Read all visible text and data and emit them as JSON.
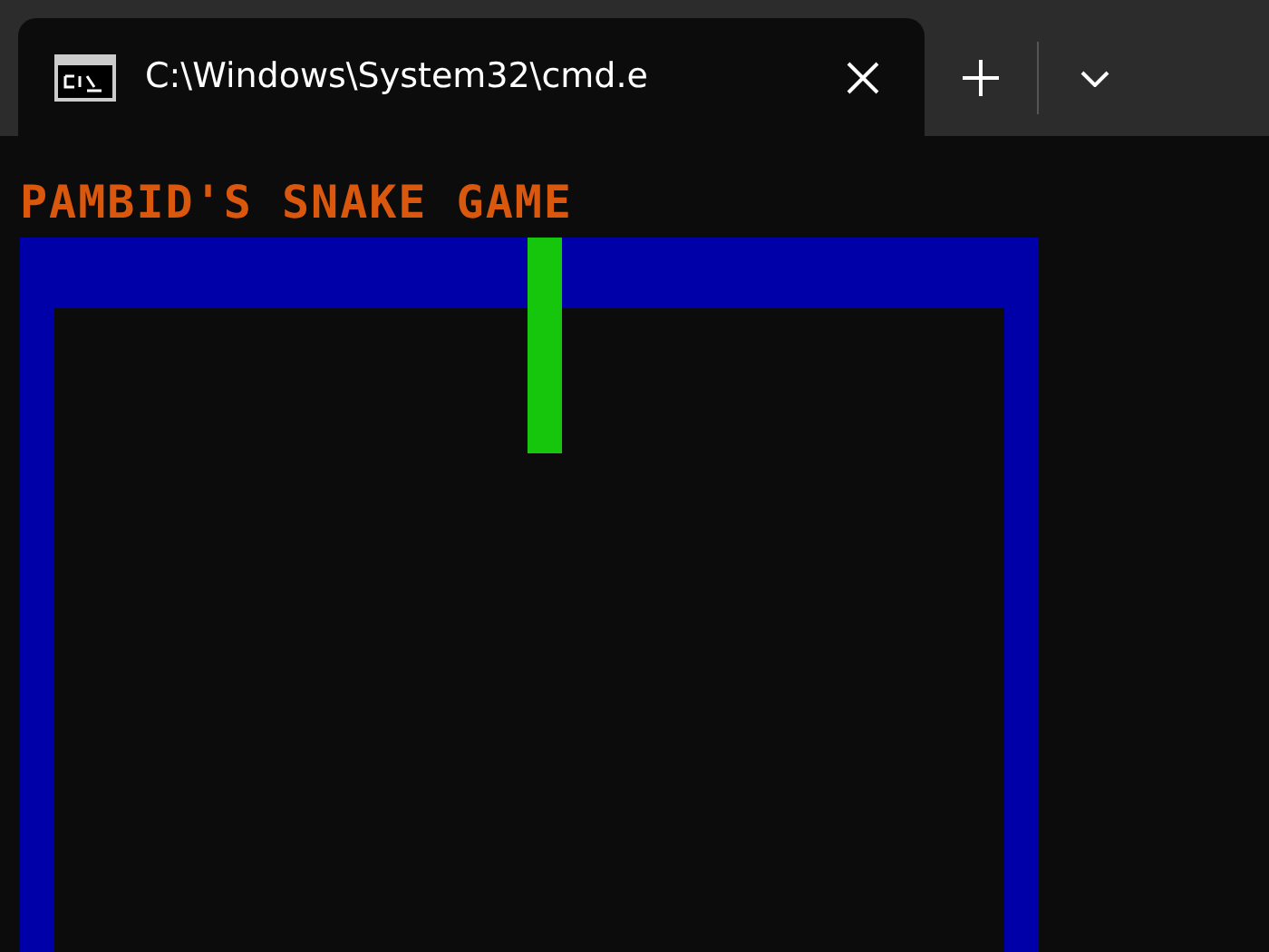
{
  "window": {
    "tabs": [
      {
        "title": "C:\\Windows\\System32\\cmd.e",
        "selected": true
      }
    ]
  },
  "terminal": {
    "heading": "PAMBID'S SNAKE GAME"
  }
}
